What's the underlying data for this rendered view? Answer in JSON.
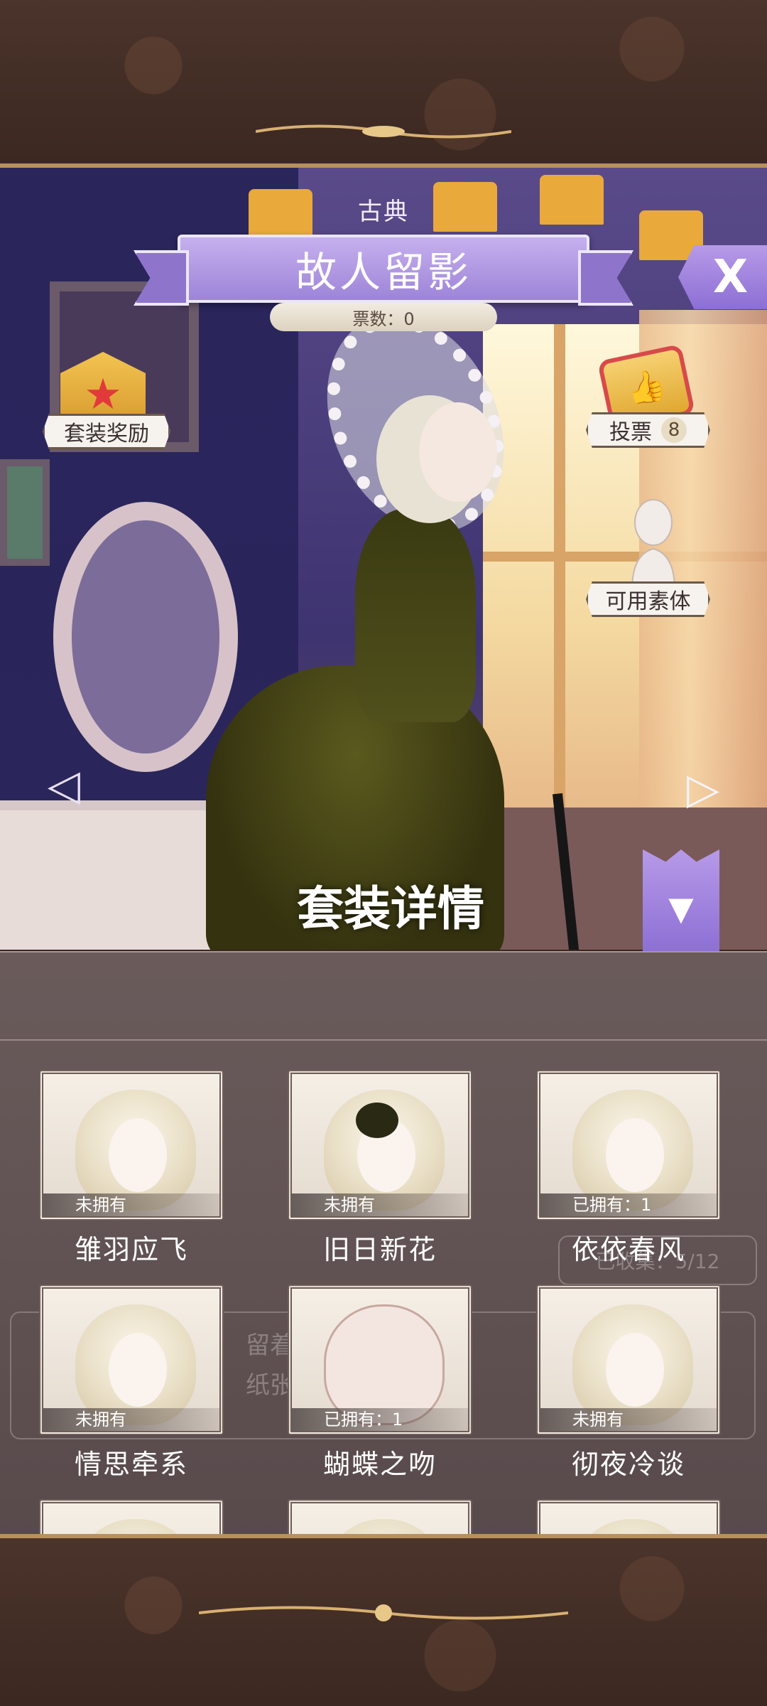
{
  "header": {
    "category": "古典",
    "title": "故人留影",
    "votes_count": "票数：0",
    "close_icon": "X"
  },
  "actions": {
    "suit_reward_label": "套装奖励",
    "vote_label": "投票",
    "vote_count": "8",
    "mannequin_label": "可用素体",
    "details_title": "套装详情"
  },
  "background_panel": {
    "progress_text": "已收集：5/12",
    "desc_line1": "留着故… 佛那未",
    "desc_line2": "纸张，… 碎。"
  },
  "items": [
    {
      "name": "雏羽应飞",
      "owned": "未拥有"
    },
    {
      "name": "旧日新花",
      "owned": "未拥有"
    },
    {
      "name": "依依春风",
      "owned": "已拥有：1"
    },
    {
      "name": "情思牵系",
      "owned": "未拥有"
    },
    {
      "name": "蝴蝶之吻",
      "owned": "已拥有：1"
    },
    {
      "name": "彻夜冷谈",
      "owned": "未拥有"
    }
  ],
  "colors": {
    "accent_purple": "#9d84d8",
    "frame_brown": "#4b342b",
    "gold": "#b89060"
  }
}
